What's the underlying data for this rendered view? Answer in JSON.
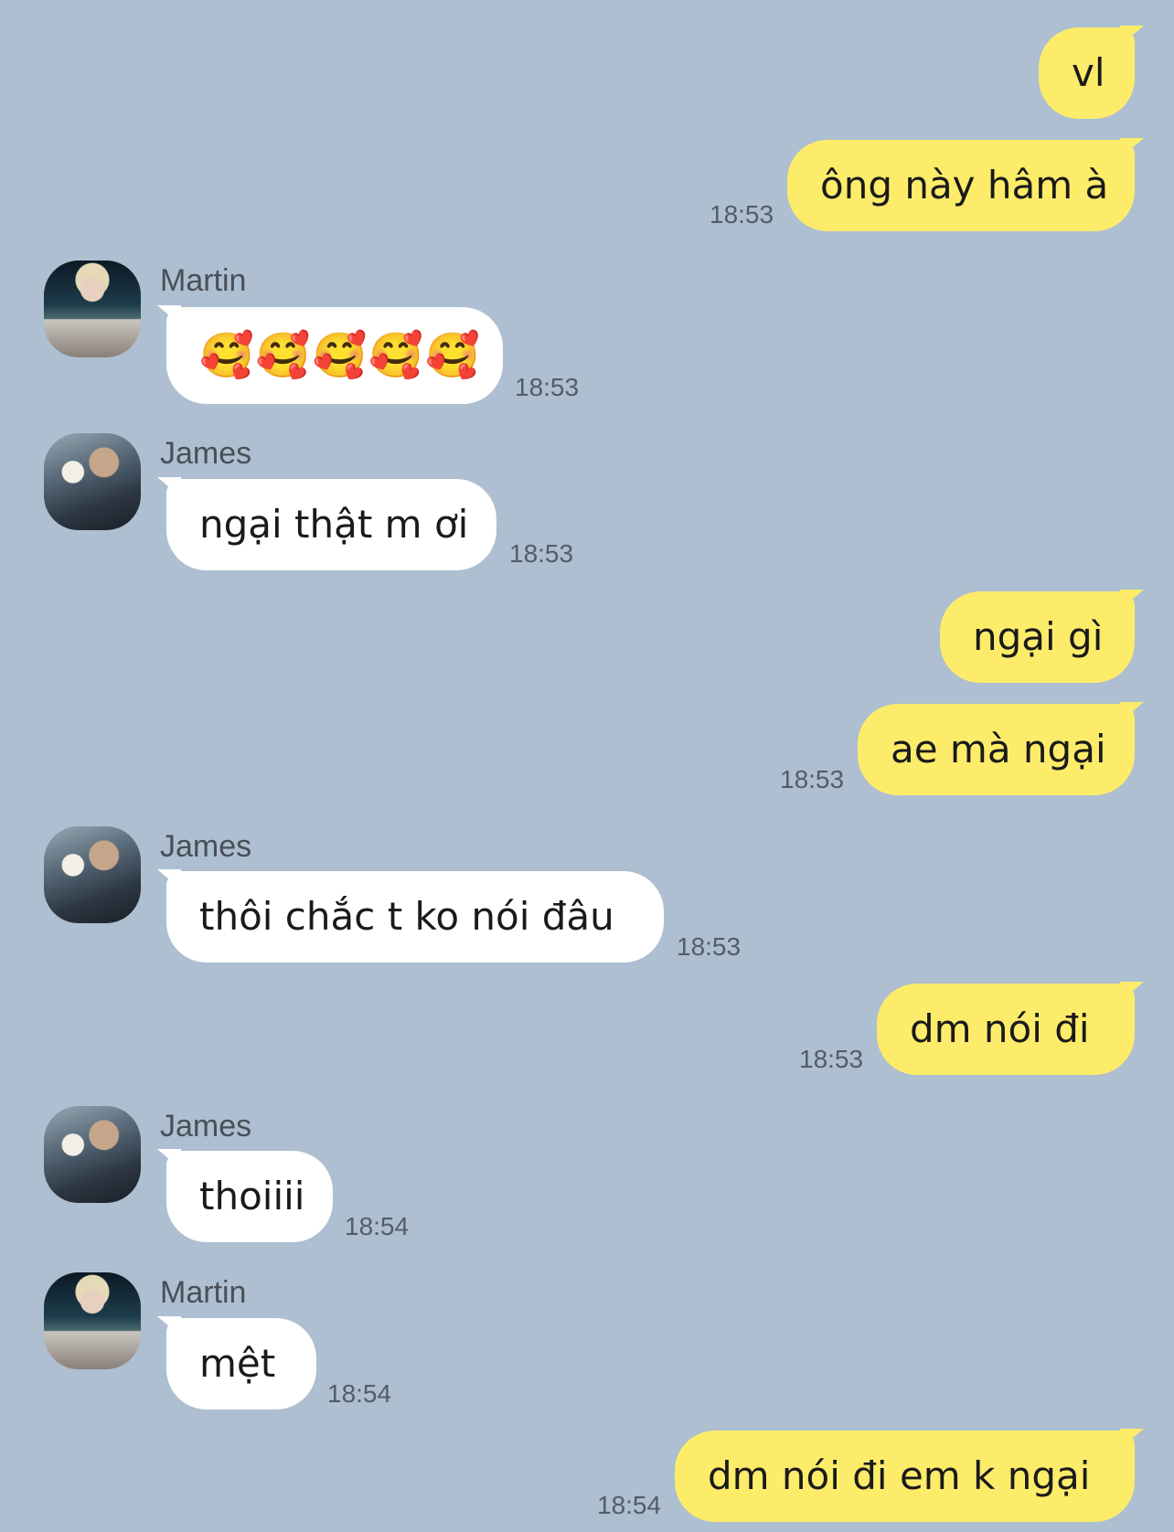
{
  "messages": [
    {
      "side": "out",
      "text": "vl",
      "time": ""
    },
    {
      "side": "out",
      "text": "ông này hâm à",
      "time": "18:53"
    },
    {
      "side": "in",
      "sender": "Martin",
      "text": "🥰🥰🥰🥰🥰",
      "time": "18:53"
    },
    {
      "side": "in",
      "sender": "James",
      "text": "ngại thật m ơi",
      "time": "18:53"
    },
    {
      "side": "out",
      "text": "ngại gì",
      "time": ""
    },
    {
      "side": "out",
      "text": "ae mà ngại",
      "time": "18:53"
    },
    {
      "side": "in",
      "sender": "James",
      "text": "thôi chắc t ko nói đâu",
      "time": "18:53"
    },
    {
      "side": "out",
      "text": "dm nói đi",
      "time": "18:53"
    },
    {
      "side": "in",
      "sender": "James",
      "text": "thoiiii",
      "time": "18:54"
    },
    {
      "side": "in",
      "sender": "Martin",
      "text": "mệt",
      "time": "18:54"
    },
    {
      "side": "out",
      "text": "dm nói đi em k ngại",
      "time": "18:54"
    }
  ],
  "colors": {
    "background": "#adbfd1",
    "outgoing_bubble": "#fdec6a",
    "incoming_bubble": "#ffffff"
  }
}
